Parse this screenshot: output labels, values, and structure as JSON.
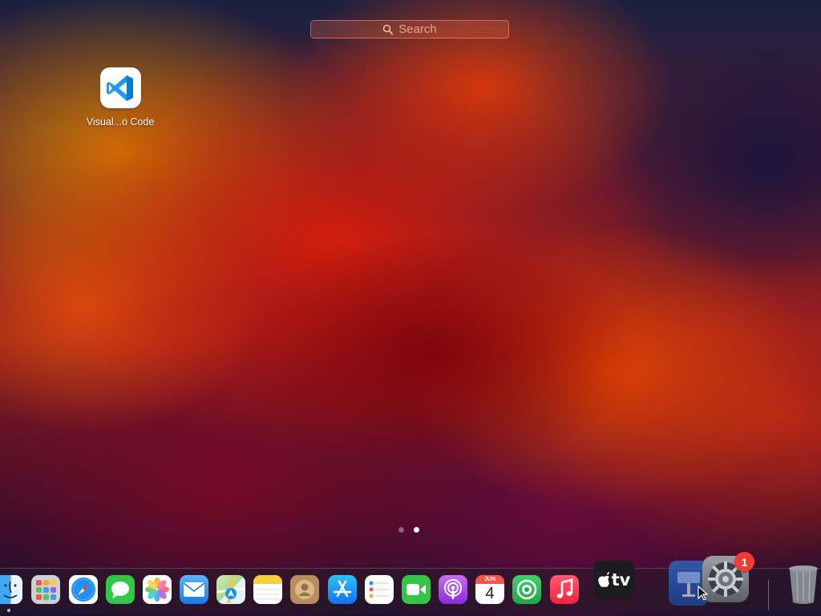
{
  "launchpad": {
    "search_placeholder": "Search",
    "apps": [
      {
        "name": "Visual...o Code",
        "icon": "vscode-icon"
      }
    ],
    "pages": {
      "count": 2,
      "current": 2
    }
  },
  "dock": {
    "items": [
      {
        "name": "Finder",
        "icon": "finder-icon",
        "running": true
      },
      {
        "name": "Launchpad",
        "icon": "launchpad-icon"
      },
      {
        "name": "Safari",
        "icon": "safari-icon"
      },
      {
        "name": "Messages",
        "icon": "messages-icon"
      },
      {
        "name": "Photos",
        "icon": "photos-icon"
      },
      {
        "name": "Mail",
        "icon": "mail-icon"
      },
      {
        "name": "Maps",
        "icon": "maps-icon"
      },
      {
        "name": "Notes",
        "icon": "notes-icon"
      },
      {
        "name": "Contacts",
        "icon": "contacts-icon"
      },
      {
        "name": "App Store",
        "icon": "app-store-icon"
      },
      {
        "name": "Reminders",
        "icon": "reminders-icon"
      },
      {
        "name": "FaceTime",
        "icon": "facetime-icon"
      },
      {
        "name": "Podcasts",
        "icon": "podcasts-icon"
      },
      {
        "name": "Calendar",
        "icon": "calendar-icon",
        "month": "JUN",
        "day": "4"
      },
      {
        "name": "Find My",
        "icon": "find-my-icon"
      },
      {
        "name": "Music",
        "icon": "music-icon"
      },
      {
        "name": "TV",
        "icon": "apple-tv-icon",
        "label": "tv"
      },
      {
        "name": "Keynote",
        "icon": "keynote-icon"
      },
      {
        "name": "System Preferences",
        "icon": "gear-icon",
        "badge": "1"
      },
      {
        "name": "Trash",
        "icon": "trash-icon"
      }
    ]
  },
  "colors": {
    "badge": "#f03c35",
    "vscode_blue": "#0a7bd3"
  }
}
